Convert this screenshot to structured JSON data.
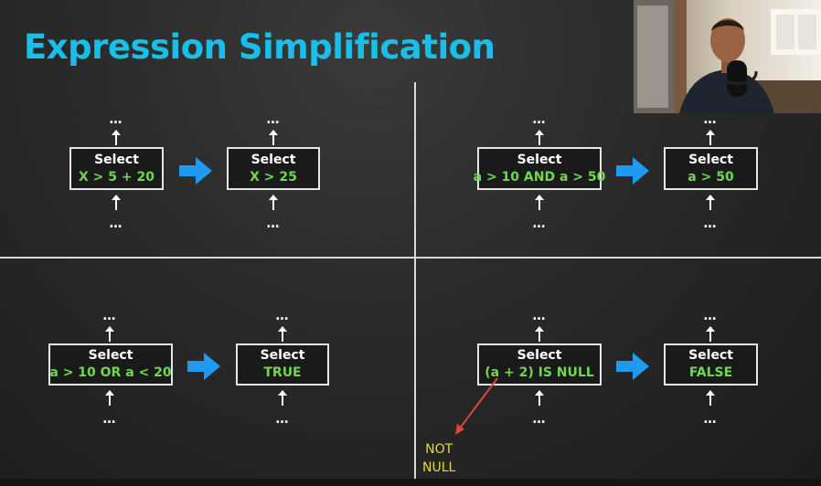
{
  "slide": {
    "title": "Expression Simplification",
    "examples": [
      {
        "before": {
          "keyword": "Select",
          "predicate": "X > 5 + 20"
        },
        "after": {
          "keyword": "Select",
          "predicate": "X > 25"
        }
      },
      {
        "before": {
          "keyword": "Select",
          "predicate": "a > 10 AND a > 50"
        },
        "after": {
          "keyword": "Select",
          "predicate": "a > 50"
        }
      },
      {
        "before": {
          "keyword": "Select",
          "predicate": "a > 10 OR a < 20"
        },
        "after": {
          "keyword": "Select",
          "predicate": "TRUE"
        }
      },
      {
        "before": {
          "keyword": "Select",
          "predicate": "(a + 2) IS NULL"
        },
        "after": {
          "keyword": "Select",
          "predicate": "FALSE"
        }
      }
    ],
    "ellipsis": "…",
    "annotation": {
      "line1": "NOT",
      "line2": "NULL"
    }
  },
  "colors": {
    "title": "#19bfe8",
    "predicate": "#6fd84e",
    "arrow": "#1e9bf0",
    "annotation": "#e8d93a",
    "annotation_arrow": "#d9493a"
  },
  "icons": {
    "transform": "right-arrow-icon",
    "flow": "up-arrow-icon"
  }
}
